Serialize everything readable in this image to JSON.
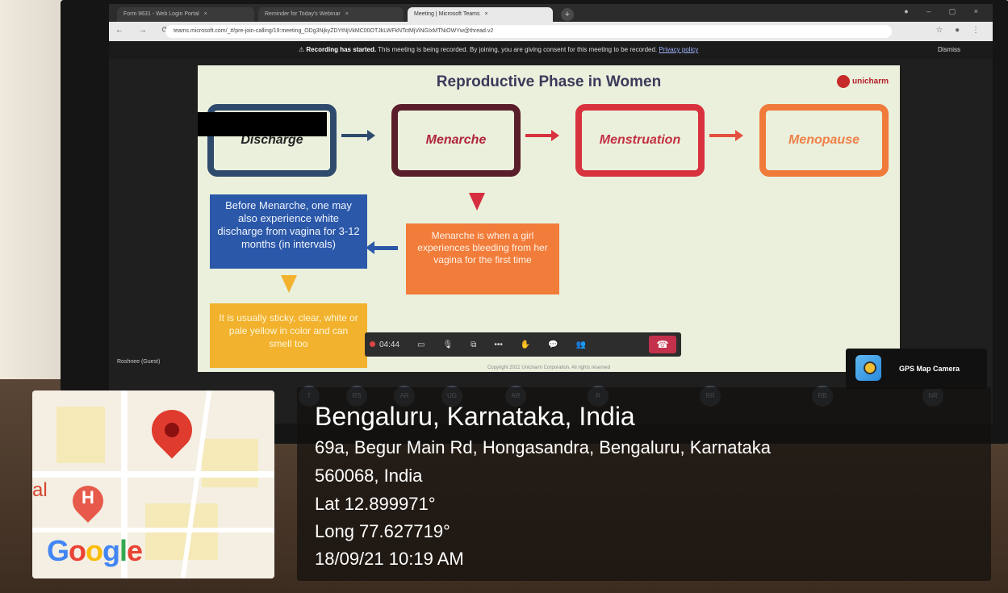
{
  "browser": {
    "tabs": [
      {
        "label": "Form 9631 - Web Login Portal",
        "active": false
      },
      {
        "label": "Reminder for Today's Webinar",
        "active": false
      },
      {
        "label": "Meeting | Microsoft Teams",
        "active": true
      }
    ],
    "url": "teams.microsoft.com/_#/pre-join-calling/19:meeting_ODg3NjkyZDYtNjVkMC00OTJkLWFkNTctMjViNGIxMTNiOWYw@thread.v2"
  },
  "recording_banner": {
    "bold": "Recording has started.",
    "message": "This meeting is being recorded. By joining, you are giving consent for this meeting to be recorded.",
    "link": "Privacy policy",
    "dismiss": "Dismiss"
  },
  "slide": {
    "title": "Reproductive Phase in Women",
    "logo": "unicharm",
    "stages": [
      "Discharge",
      "Menarche",
      "Menstruation",
      "Menopause"
    ],
    "box_blue": "Before Menarche, one may also experience white discharge from vagina for 3-12 months (in intervals)",
    "box_orange": "Menarche is when a girl experiences bleeding from her vagina for the first time",
    "box_yellow": "It is usually sticky, clear, white or pale yellow in color and can smell too",
    "copyright": "Copyright 2021 Unicharm Corporation. All rights reserved"
  },
  "meeting": {
    "timer": "04:44",
    "guest_label": "Roshnee (Guest)",
    "avatars": [
      "T",
      "RS",
      "AR",
      "UG",
      "AR",
      "R",
      "RR",
      "RB",
      "NR"
    ]
  },
  "gps_app": {
    "badge": "GPS Map Camera",
    "city": "Bengaluru, Karnataka, India",
    "address_line1": "69a, Begur Main Rd, Hongasandra, Bengaluru, Karnataka",
    "address_line2": "560068, India",
    "lat": "Lat 12.899971°",
    "long": "Long 77.627719°",
    "datetime": "18/09/21 10:19 AM",
    "map_label_fragment": "al",
    "hospital_marker": "H",
    "map_brand": "Google"
  }
}
